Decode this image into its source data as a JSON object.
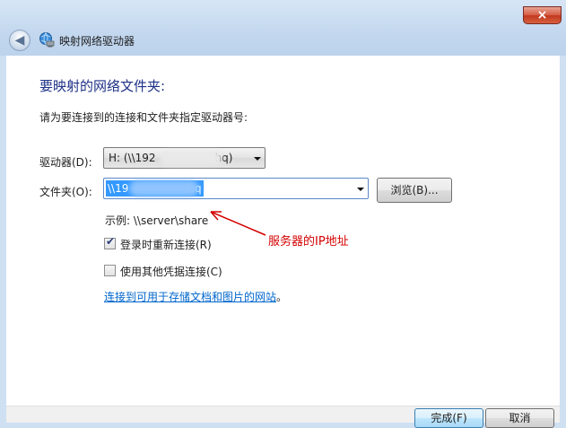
{
  "window": {
    "title": "映射网络驱动器",
    "close_glyph": "×",
    "back_glyph": "◀"
  },
  "main": {
    "heading": "要映射的网络文件夹:",
    "instruction": "请为要连接到的连接和文件夹指定驱动器号:",
    "drive_label": "驱动器(D):",
    "drive_value_a": "H: (\\\\192",
    "drive_value_b": "hq)",
    "folder_label": "文件夹(O):",
    "folder_value_a": "\\\\19",
    "folder_value_b": "hq",
    "browse_label": "浏览(B)...",
    "example": "示例: \\\\server\\share",
    "reconnect_label": "登录时重新连接(R)",
    "reconnect_checked": "✔",
    "other_credentials_label": "使用其他凭据连接(C)",
    "link_text": "连接到可用于存储文档和图片的网站",
    "link_suffix": "。"
  },
  "annotation": {
    "text": "服务器的IP地址",
    "color": "#d40000"
  },
  "footer": {
    "finish_label": "完成(F)",
    "cancel_label": "取消"
  },
  "colors": {
    "heading": "#1e3287",
    "selection": "#3399ff",
    "link": "#0066cc"
  }
}
